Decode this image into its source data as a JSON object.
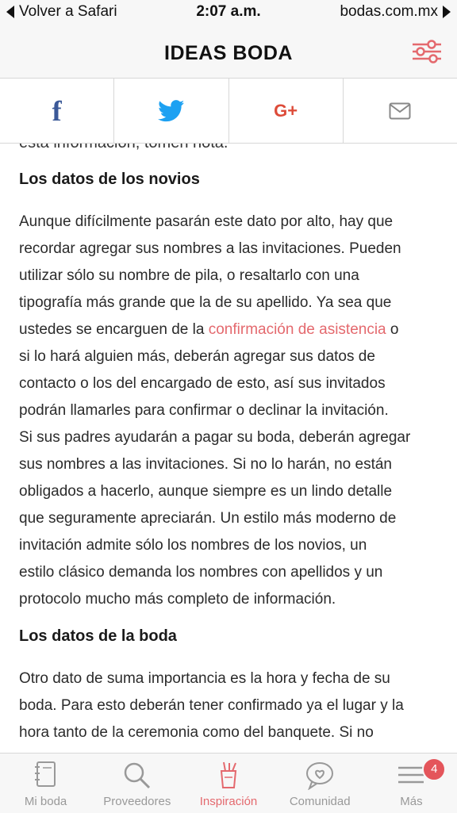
{
  "status_bar": {
    "back_label": "Volver a Safari",
    "time": "2:07 a.m.",
    "site": "bodas.com.mx"
  },
  "header": {
    "title": "IDEAS BODA"
  },
  "share": {
    "facebook": "f",
    "google": "G+"
  },
  "article": {
    "cut_line": "esta información, tomen nota.",
    "section1_title": "Los datos de los novios",
    "p1_l1": "Aunque difícilmente pasarán este dato por alto, hay que",
    "p1_l2": "recordar agregar sus nombres a las invitaciones. Pueden",
    "p1_l3": "utilizar sólo su nombre de pila, o resaltarlo con una",
    "p1_l4": "tipografía más grande que la de su apellido. Ya sea que",
    "p1_l5_pre": "ustedes se encarguen de la ",
    "p1_l5_link": "confirmación de asistencia",
    "p1_l5_post": " o",
    "p1_l6": "si lo hará alguien más, deberán agregar sus datos de",
    "p1_l7": "contacto o los del encargado de esto, así sus invitados",
    "p1_l8": "podrán llamarles para confirmar o declinar la invitación.",
    "p1_l9": "Si sus padres ayudarán a pagar su boda, deberán agregar",
    "p1_l10": "sus nombres a las invitaciones. Si no lo harán, no están",
    "p1_l11": "obligados a hacerlo, aunque siempre es un lindo detalle",
    "p1_l12": "que seguramente apreciarán. Un estilo más moderno de",
    "p1_l13": "invitación admite sólo los nombres de los novios, un",
    "p1_l14": "estilo clásico demanda los nombres con apellidos y un",
    "p1_l15": "protocolo mucho más completo de información.",
    "section2_title": "Los datos de la boda",
    "p2_l1": "Otro dato de suma importancia es la hora y fecha de su",
    "p2_l2": "boda. Para esto deberán tener confirmado ya el lugar y la",
    "p2_l3": "hora tanto de la ceremonia como del banquete. Si no"
  },
  "tabbar": {
    "tabs": [
      {
        "label": "Mi boda",
        "icon": "notebook-icon"
      },
      {
        "label": "Proveedores",
        "icon": "search-icon"
      },
      {
        "label": "Inspiración",
        "icon": "inspiration-icon"
      },
      {
        "label": "Comunidad",
        "icon": "community-icon"
      },
      {
        "label": "Más",
        "icon": "menu-icon"
      }
    ],
    "badge_count": "4"
  },
  "colors": {
    "accent": "#e4696e",
    "facebook": "#3b5998",
    "twitter": "#1da1f2",
    "google": "#dd4b39"
  }
}
